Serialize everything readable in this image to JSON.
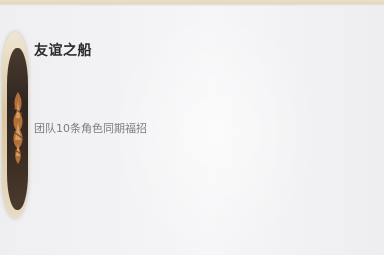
{
  "achievement": {
    "title": "友谊之船",
    "description": "团队10条角色同期福招",
    "badge_icon": "ship-emblem-icon",
    "colors": {
      "badge_ring": "#d9c6a1",
      "badge_core": "#2f2620",
      "emblem": "#c98a4a",
      "title_text": "#2a2a2a",
      "description_text": "#7c7c80",
      "top_strip": "#e2d7c0"
    }
  }
}
